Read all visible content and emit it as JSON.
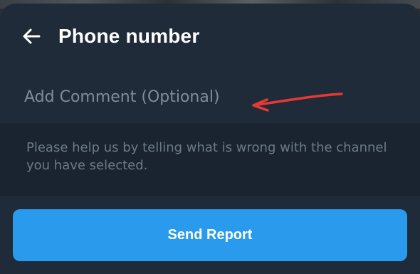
{
  "header": {
    "title": "Phone number",
    "back_icon": "arrow-left-icon"
  },
  "comment": {
    "placeholder": "Add Comment (Optional)",
    "value": ""
  },
  "help": {
    "text": "Please help us by telling what is wrong with the channel you have selected."
  },
  "footer": {
    "send_label": "Send Report"
  },
  "colors": {
    "sheet_bg": "#1f2b38",
    "help_bg": "#1a2430",
    "accent": "#2a9bec",
    "annotation": "#e53935",
    "placeholder": "#7f8c99",
    "help_text": "#6c7a88"
  }
}
